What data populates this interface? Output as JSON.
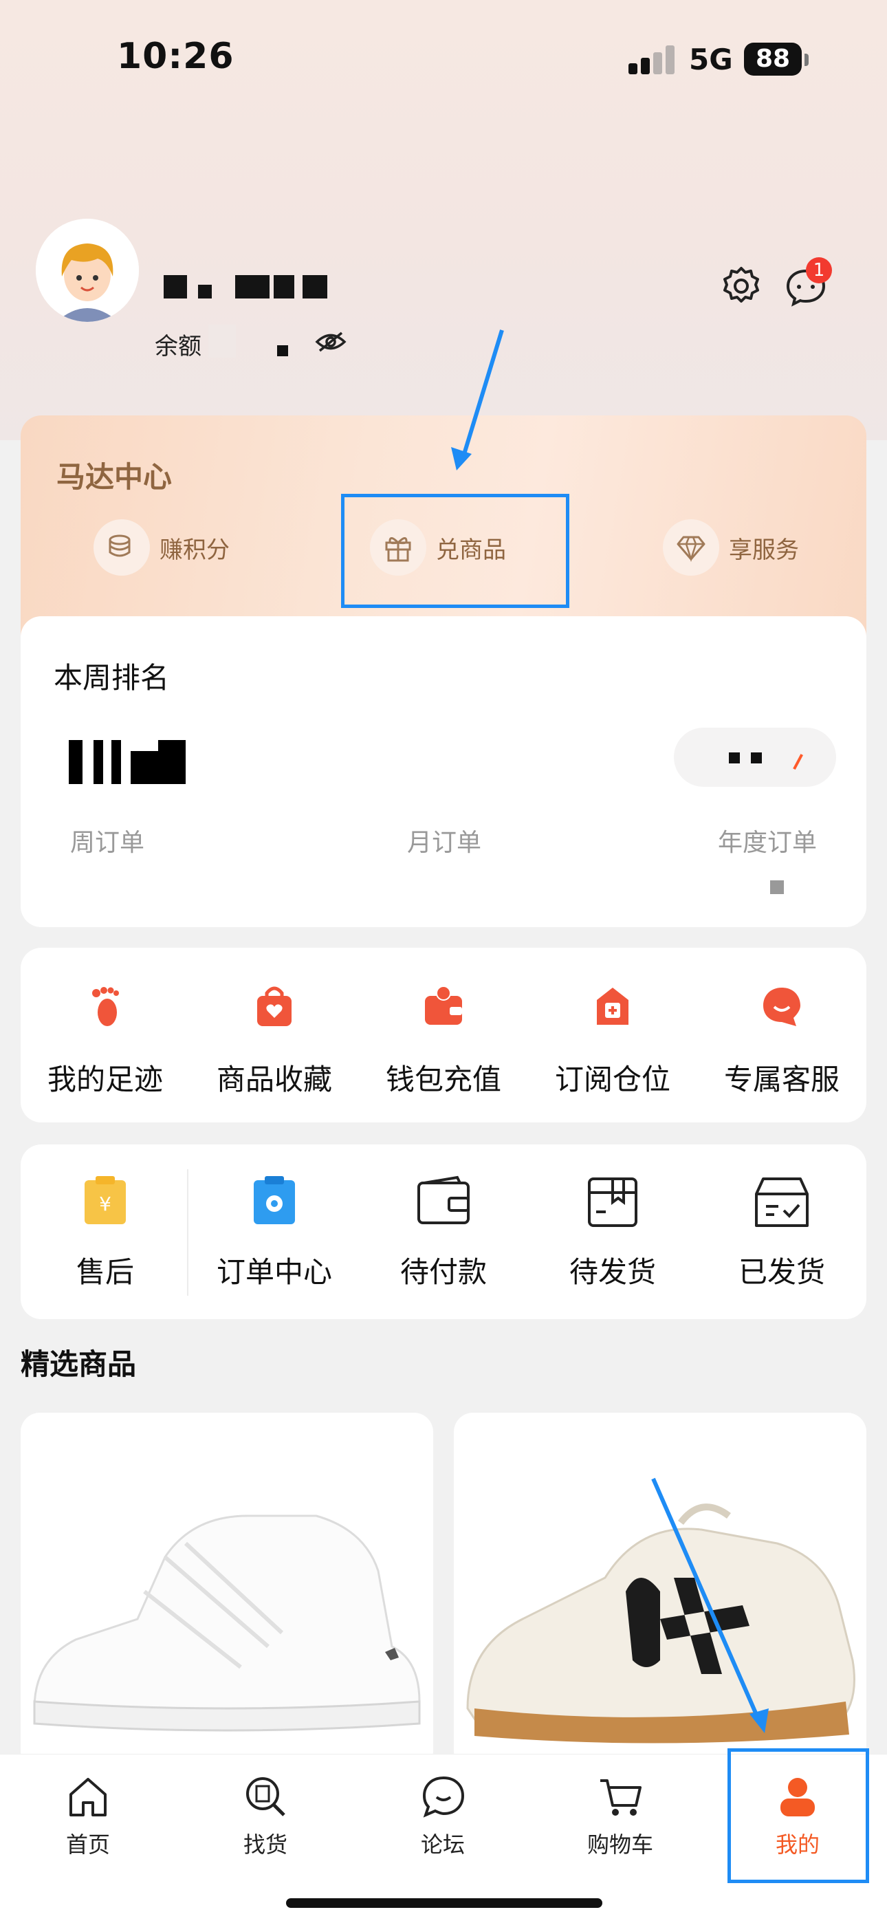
{
  "status_bar": {
    "time": "10:26",
    "network": "5G",
    "battery": "88"
  },
  "profile": {
    "balance_label": "余额",
    "message_badge": "1"
  },
  "mada_center": {
    "title": "马达中心",
    "items": [
      {
        "label": "赚积分",
        "icon": "coins-icon"
      },
      {
        "label": "兑商品",
        "icon": "gift-icon"
      },
      {
        "label": "享服务",
        "icon": "diamond-icon"
      }
    ]
  },
  "ranking": {
    "title": "本周排名",
    "labels": [
      "周订单",
      "月订单",
      "年度订单"
    ]
  },
  "services": [
    {
      "label": "我的足迹",
      "icon": "footprint-icon"
    },
    {
      "label": "商品收藏",
      "icon": "favorite-bag-icon"
    },
    {
      "label": "钱包充值",
      "icon": "wallet-icon"
    },
    {
      "label": "订阅仓位",
      "icon": "subscribe-icon"
    },
    {
      "label": "专属客服",
      "icon": "customer-service-icon"
    }
  ],
  "orders": [
    {
      "label": "售后",
      "icon": "after-sales-icon"
    },
    {
      "label": "订单中心",
      "icon": "order-center-icon"
    },
    {
      "label": "待付款",
      "icon": "pending-payment-icon"
    },
    {
      "label": "待发货",
      "icon": "pending-shipment-icon"
    },
    {
      "label": "已发货",
      "icon": "shipped-icon"
    }
  ],
  "featured": {
    "title": "精选商品"
  },
  "tabbar": [
    {
      "label": "首页",
      "icon": "home-icon"
    },
    {
      "label": "找货",
      "icon": "find-goods-icon"
    },
    {
      "label": "论坛",
      "icon": "forum-icon"
    },
    {
      "label": "购物车",
      "icon": "cart-icon"
    },
    {
      "label": "我的",
      "icon": "profile-icon",
      "active": true
    }
  ],
  "colors": {
    "accent": "#f45a24",
    "highlight": "#1e8cf5",
    "mada_text": "#8f6540"
  }
}
